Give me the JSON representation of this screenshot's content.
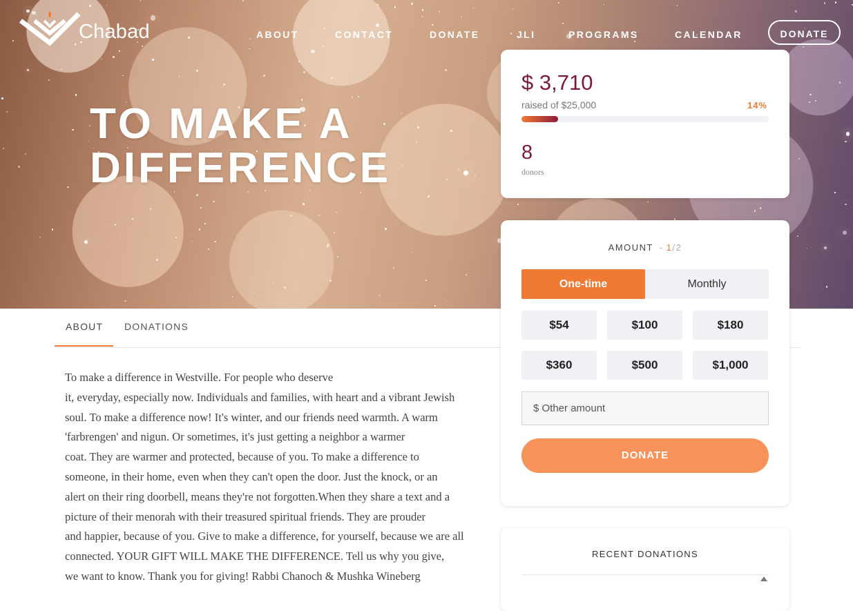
{
  "brand": {
    "name": "Chabad"
  },
  "nav": {
    "links": [
      "ABOUT",
      "CONTACT",
      "DONATE",
      "JLI",
      "PROGRAMS",
      "CALENDAR"
    ],
    "donate_button": "DONATE"
  },
  "hero": {
    "title_line1": "TO MAKE A",
    "title_line2": "DIFFERENCE"
  },
  "stats": {
    "raised": "$ 3,710",
    "goal_text": "raised of $25,000",
    "percent_label": "14%",
    "progress_fraction": 0.14,
    "donors_count": "8",
    "donors_label": "donors"
  },
  "form": {
    "header_label": "AMOUNT",
    "header_sep": "-",
    "step_current": "1",
    "step_total": "/2",
    "frequency": [
      "One-time",
      "Monthly"
    ],
    "amounts": [
      "$54",
      "$100",
      "$180",
      "$360",
      "$500",
      "$1,000"
    ],
    "other_placeholder": "$ Other amount",
    "donate_label": "DONATE"
  },
  "recent": {
    "header": "RECENT DONATIONS"
  },
  "tabs": [
    "ABOUT",
    "DONATIONS"
  ],
  "about_lines": [
    "To make a difference in Westville. For people who deserve",
    "it, everyday, especially now. Individuals and families, with heart and a vibrant Jewish",
    "soul. To make a difference now! It's winter, and our friends need warmth. A warm",
    "'farbrengen' and nigun. Or sometimes, it's just getting a neighbor a warmer",
    "coat. They are warmer and protected, because of you. To make a difference to",
    "someone, in their home, even when they can't open the door. Just the knock, or an",
    "alert on their ring doorbell, means they're not forgotten.When they share a text and a",
    "picture of their menorah with their treasured spiritual friends. They are prouder",
    "and happier, because of you. Give to make a difference, for yourself, because we are all",
    "connected. YOUR GIFT WILL MAKE THE DIFFERENCE. Tell us why you give,",
    "we want to know. Thank you for giving! Rabbi Chanoch & Mushka Wineberg"
  ],
  "colors": {
    "accent": "#f07a33",
    "maroon": "#7c1a36",
    "donate_button": "#f5935a"
  }
}
